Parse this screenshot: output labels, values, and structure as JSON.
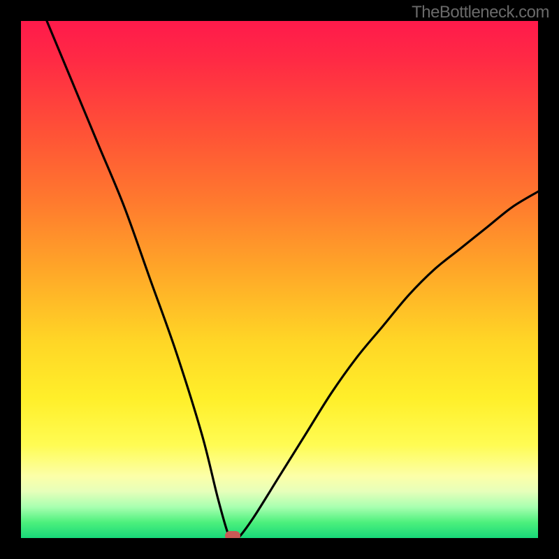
{
  "watermark": "TheBottleneck.com",
  "chart_data": {
    "type": "line",
    "title": "",
    "xlabel": "",
    "ylabel": "",
    "xlim": [
      0,
      100
    ],
    "ylim": [
      0,
      100
    ],
    "grid": false,
    "legend": null,
    "series": [
      {
        "name": "bottleneck-curve",
        "x": [
          5,
          10,
          15,
          20,
          25,
          30,
          35,
          38,
          40,
          41,
          42,
          45,
          50,
          55,
          60,
          65,
          70,
          75,
          80,
          85,
          90,
          95,
          100
        ],
        "y": [
          100,
          88,
          76,
          64,
          50,
          36,
          20,
          8,
          1,
          0,
          0,
          4,
          12,
          20,
          28,
          35,
          41,
          47,
          52,
          56,
          60,
          64,
          67
        ]
      }
    ],
    "marker": {
      "x": 41,
      "y": 0
    },
    "colors": {
      "background_top": "#ff1a4b",
      "background_bottom": "#18d87a",
      "curve": "#000000",
      "marker": "#c95a56"
    }
  }
}
